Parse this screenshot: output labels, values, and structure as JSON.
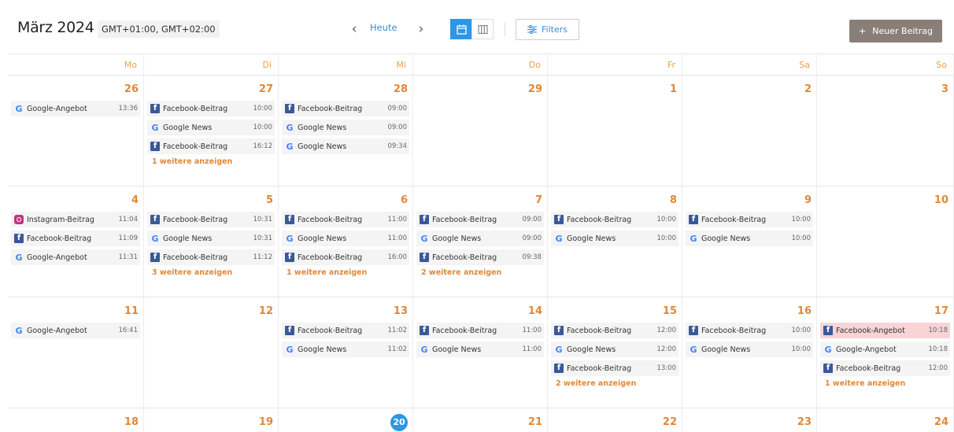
{
  "header": {
    "title": "März 2024",
    "timezone": "GMT+01:00, GMT+02:00",
    "prev_icon": "‹",
    "today_label": "Heute",
    "next_icon": "›",
    "filters_label": "Filters",
    "new_post_label": "Neuer Beitrag",
    "new_post_plus": "+"
  },
  "weekdays": [
    "Mo",
    "Di",
    "Mi",
    "Do",
    "Fr",
    "Sa",
    "So"
  ],
  "colors": {
    "accent_orange": "#e0883a",
    "today_blue": "#2d97e6",
    "facebook_blue": "#3b5998",
    "button_taupe": "#8a7f78",
    "highlight_pink": "#f8d4d6"
  },
  "weeks": [
    {
      "days": [
        {
          "num": "26",
          "posts": [
            {
              "type": "google",
              "title": "Google-Angebot",
              "time": "13:36"
            }
          ]
        },
        {
          "num": "27",
          "posts": [
            {
              "type": "facebook",
              "title": "Facebook-Beitrag",
              "time": "10:00"
            },
            {
              "type": "google",
              "title": "Google News",
              "time": "10:00"
            },
            {
              "type": "facebook",
              "title": "Facebook-Beitrag",
              "time": "16:12"
            }
          ],
          "more": "1 weitere anzeigen"
        },
        {
          "num": "28",
          "posts": [
            {
              "type": "facebook",
              "title": "Facebook-Beitrag",
              "time": "09:00"
            },
            {
              "type": "google",
              "title": "Google News",
              "time": "09:00"
            },
            {
              "type": "google",
              "title": "Google News",
              "time": "09:34"
            }
          ]
        },
        {
          "num": "29",
          "posts": []
        },
        {
          "num": "1",
          "posts": []
        },
        {
          "num": "2",
          "posts": []
        },
        {
          "num": "3",
          "posts": []
        }
      ]
    },
    {
      "days": [
        {
          "num": "4",
          "posts": [
            {
              "type": "instagram",
              "title": "Instagram-Beitrag",
              "time": "11:04"
            },
            {
              "type": "facebook",
              "title": "Facebook-Beitrag",
              "time": "11:09"
            },
            {
              "type": "google",
              "title": "Google-Angebot",
              "time": "11:31"
            }
          ]
        },
        {
          "num": "5",
          "posts": [
            {
              "type": "facebook",
              "title": "Facebook-Beitrag",
              "time": "10:31"
            },
            {
              "type": "google",
              "title": "Google News",
              "time": "10:31"
            },
            {
              "type": "facebook",
              "title": "Facebook-Beitrag",
              "time": "11:12"
            }
          ],
          "more": "3 weitere anzeigen"
        },
        {
          "num": "6",
          "posts": [
            {
              "type": "facebook",
              "title": "Facebook-Beitrag",
              "time": "11:00"
            },
            {
              "type": "google",
              "title": "Google News",
              "time": "11:00"
            },
            {
              "type": "facebook",
              "title": "Facebook-Beitrag",
              "time": "16:00"
            }
          ],
          "more": "1 weitere anzeigen"
        },
        {
          "num": "7",
          "posts": [
            {
              "type": "facebook",
              "title": "Facebook-Beitrag",
              "time": "09:00"
            },
            {
              "type": "google",
              "title": "Google News",
              "time": "09:00"
            },
            {
              "type": "facebook",
              "title": "Facebook-Beitrag",
              "time": "09:38"
            }
          ],
          "more": "2 weitere anzeigen"
        },
        {
          "num": "8",
          "posts": [
            {
              "type": "facebook",
              "title": "Facebook-Beitrag",
              "time": "10:00"
            },
            {
              "type": "google",
              "title": "Google News",
              "time": "10:00"
            }
          ]
        },
        {
          "num": "9",
          "posts": [
            {
              "type": "facebook",
              "title": "Facebook-Beitrag",
              "time": "10:00"
            },
            {
              "type": "google",
              "title": "Google News",
              "time": "10:00"
            }
          ]
        },
        {
          "num": "10",
          "posts": []
        }
      ]
    },
    {
      "days": [
        {
          "num": "11",
          "posts": [
            {
              "type": "google",
              "title": "Google-Angebot",
              "time": "16:41"
            }
          ]
        },
        {
          "num": "12",
          "posts": []
        },
        {
          "num": "13",
          "posts": [
            {
              "type": "facebook",
              "title": "Facebook-Beitrag",
              "time": "11:02"
            },
            {
              "type": "google",
              "title": "Google News",
              "time": "11:02"
            }
          ]
        },
        {
          "num": "14",
          "posts": [
            {
              "type": "facebook",
              "title": "Facebook-Beitrag",
              "time": "11:00"
            },
            {
              "type": "google",
              "title": "Google News",
              "time": "11:00"
            }
          ]
        },
        {
          "num": "15",
          "posts": [
            {
              "type": "facebook",
              "title": "Facebook-Beitrag",
              "time": "12:00"
            },
            {
              "type": "google",
              "title": "Google News",
              "time": "12:00"
            },
            {
              "type": "facebook",
              "title": "Facebook-Beitrag",
              "time": "13:00"
            }
          ],
          "more": "2 weitere anzeigen"
        },
        {
          "num": "16",
          "posts": [
            {
              "type": "facebook",
              "title": "Facebook-Beitrag",
              "time": "10:00"
            },
            {
              "type": "google",
              "title": "Google News",
              "time": "10:00"
            }
          ]
        },
        {
          "num": "17",
          "posts": [
            {
              "type": "facebook",
              "title": "Facebook-Angebot",
              "time": "10:18",
              "highlight": true
            },
            {
              "type": "google",
              "title": "Google-Angebot",
              "time": "10:18"
            },
            {
              "type": "facebook",
              "title": "Facebook-Beitrag",
              "time": "12:00"
            }
          ],
          "more": "1 weitere anzeigen"
        }
      ]
    },
    {
      "days": [
        {
          "num": "18",
          "posts": []
        },
        {
          "num": "19",
          "posts": []
        },
        {
          "num": "20",
          "posts": [],
          "today": true
        },
        {
          "num": "21",
          "posts": []
        },
        {
          "num": "22",
          "posts": []
        },
        {
          "num": "23",
          "posts": []
        },
        {
          "num": "24",
          "posts": []
        }
      ]
    }
  ]
}
